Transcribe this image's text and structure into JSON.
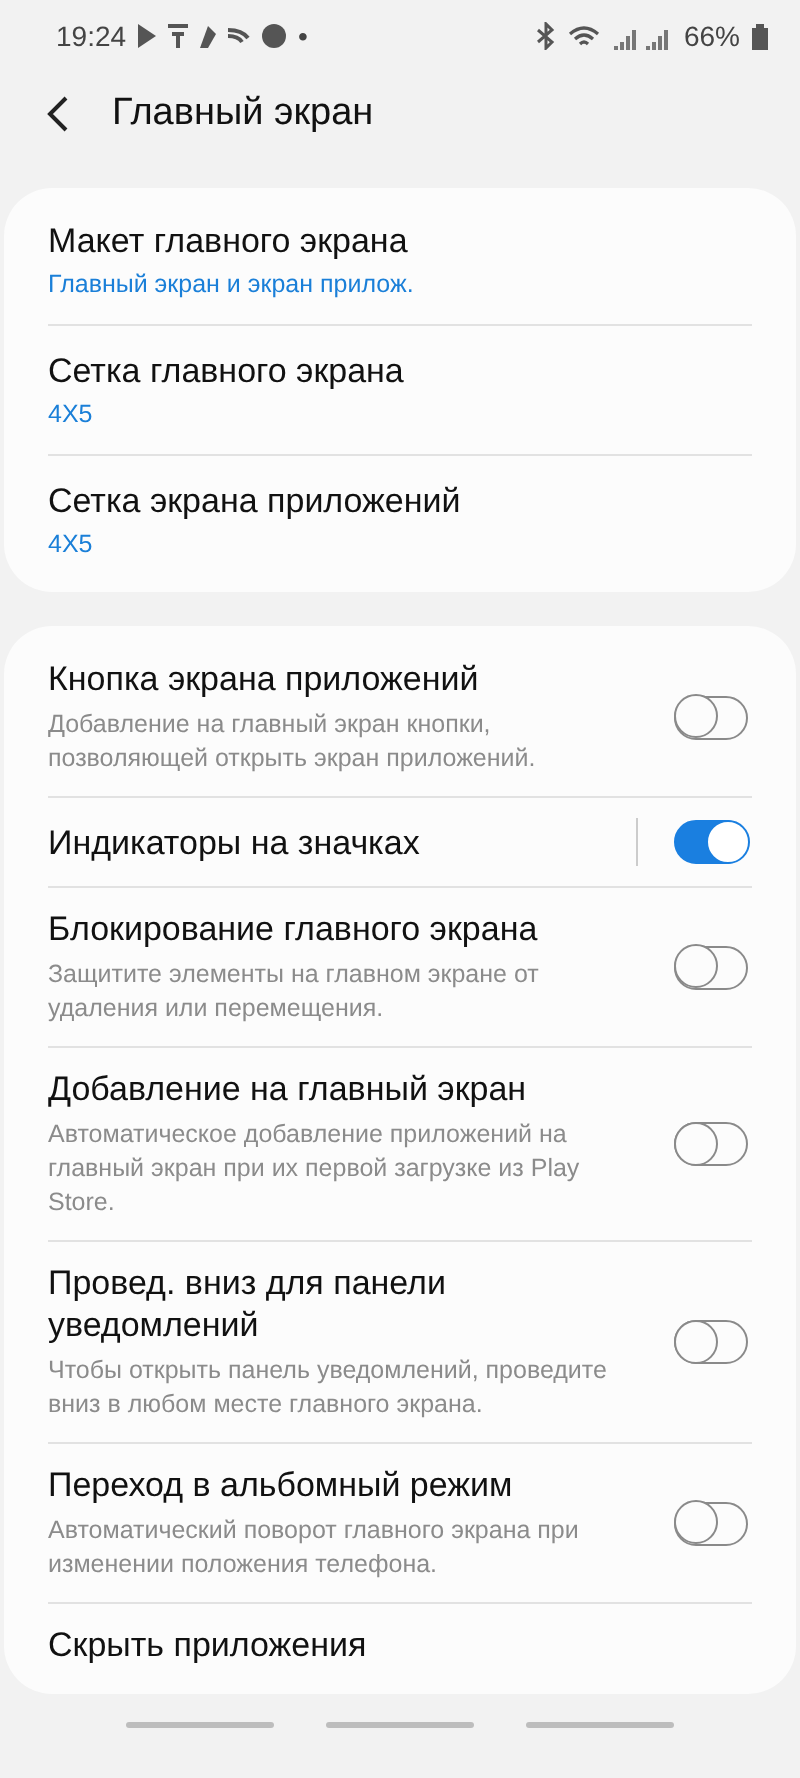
{
  "status_bar": {
    "time": "19:24",
    "dot": "•",
    "battery": "66%"
  },
  "header": {
    "title": "Главный экран"
  },
  "layout_group": [
    {
      "title": "Макет главного экрана",
      "value": "Главный экран и экран прилож."
    },
    {
      "title": "Сетка главного экрана",
      "value": "4X5"
    },
    {
      "title": "Сетка экрана приложений",
      "value": "4X5"
    }
  ],
  "settings": [
    {
      "kind": "switch",
      "title": "Кнопка экрана приложений",
      "description": "Добавление на главный экран кнопки, позволяющей открыть экран приложений.",
      "on": false
    },
    {
      "kind": "split_switch",
      "title": "Индикаторы на значках",
      "on": true
    },
    {
      "kind": "switch",
      "title": "Блокирование главного экрана",
      "description": "Защитите элементы на главном экране от удаления или перемещения.",
      "on": false
    },
    {
      "kind": "switch",
      "title": "Добавление на главный экран",
      "description": "Автоматическое добавление приложений на главный экран при их первой загрузке из Play Store.",
      "on": false
    },
    {
      "kind": "switch",
      "title": "Провед. вниз для панели уведомлений",
      "description": "Чтобы открыть панель уведомлений, проведите вниз в любом месте главного экрана.",
      "on": false
    },
    {
      "kind": "switch",
      "title": "Переход в альбомный режим",
      "description": "Автоматический поворот главного экрана при изменении положения телефона.",
      "on": false
    },
    {
      "kind": "link",
      "title": "Скрыть приложения"
    }
  ]
}
